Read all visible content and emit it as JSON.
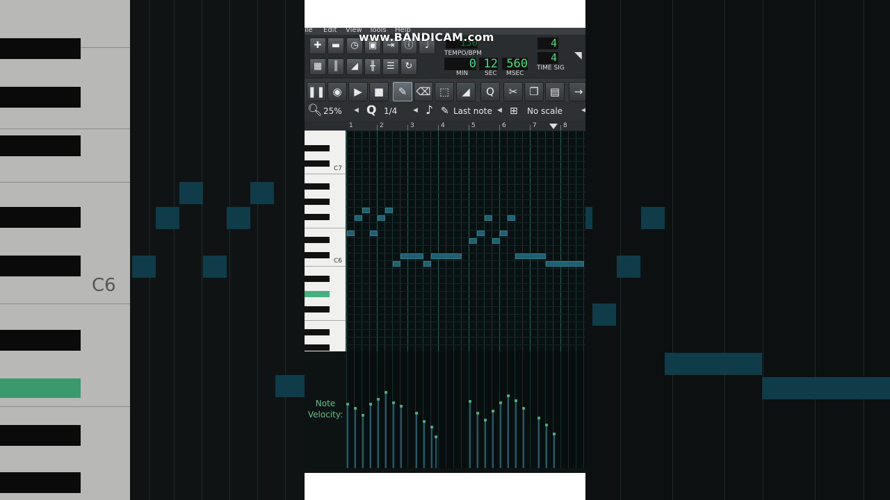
{
  "menu": [
    "ile",
    "Edit",
    "View",
    "Tools",
    "Help"
  ],
  "watermark": "www.BANDICAM.com",
  "transport": {
    "tempo_value": "130",
    "tempo_label": "TEMPO/BPM",
    "min_value": "0",
    "min_label": "MIN",
    "sec_value": "12",
    "sec_label": "SEC",
    "msec_value": "560",
    "msec_label": "MSEC",
    "time_sig_top": "4",
    "time_sig_bottom": "4",
    "time_sig_label": "TIME SIG"
  },
  "options": {
    "zoom": "25%",
    "quantize": "1/4",
    "note_length": "Last note",
    "scale": "No scale"
  },
  "ruler": [
    "1",
    "2",
    "3",
    "4",
    "5",
    "6",
    "7",
    "8"
  ],
  "keys": {
    "c7": "C7",
    "c6": "C6"
  },
  "side_label": "C6",
  "velocity": {
    "label_line1": "Note",
    "label_line2": "Velocity:"
  },
  "colors": {
    "accent": "#46b07e",
    "note": "#1e5f70",
    "lcd": "#3fe07e",
    "grid_bg": "#091012"
  },
  "notes": [
    {
      "pos": 0,
      "row": 13,
      "len": 1
    },
    {
      "pos": 1,
      "row": 11,
      "len": 1
    },
    {
      "pos": 2,
      "row": 10,
      "len": 1
    },
    {
      "pos": 3,
      "row": 13,
      "len": 1
    },
    {
      "pos": 4,
      "row": 11,
      "len": 1
    },
    {
      "pos": 5,
      "row": 10,
      "len": 1
    },
    {
      "pos": 6,
      "row": 17,
      "len": 1
    },
    {
      "pos": 7,
      "row": 16,
      "len": 3
    },
    {
      "pos": 10,
      "row": 17,
      "len": 1
    },
    {
      "pos": 11,
      "row": 16,
      "len": 4
    },
    {
      "pos": 16,
      "row": 14,
      "len": 1
    },
    {
      "pos": 17,
      "row": 13,
      "len": 1
    },
    {
      "pos": 18,
      "row": 11,
      "len": 1
    },
    {
      "pos": 19,
      "row": 14,
      "len": 1
    },
    {
      "pos": 20,
      "row": 13,
      "len": 1
    },
    {
      "pos": 21,
      "row": 11,
      "len": 1
    },
    {
      "pos": 22,
      "row": 16,
      "len": 4
    },
    {
      "pos": 26,
      "row": 17,
      "len": 5
    }
  ],
  "velocities": [
    {
      "pos": 0,
      "level": 0.55
    },
    {
      "pos": 1,
      "level": 0.51
    },
    {
      "pos": 2,
      "level": 0.45
    },
    {
      "pos": 3,
      "level": 0.55
    },
    {
      "pos": 4,
      "level": 0.59
    },
    {
      "pos": 5,
      "level": 0.65
    },
    {
      "pos": 6,
      "level": 0.56
    },
    {
      "pos": 7,
      "level": 0.53
    },
    {
      "pos": 9,
      "level": 0.47
    },
    {
      "pos": 10,
      "level": 0.4
    },
    {
      "pos": 11,
      "level": 0.35
    },
    {
      "pos": 11.5,
      "level": 0.27
    },
    {
      "pos": 16,
      "level": 0.57
    },
    {
      "pos": 17,
      "level": 0.47
    },
    {
      "pos": 18,
      "level": 0.41
    },
    {
      "pos": 19,
      "level": 0.49
    },
    {
      "pos": 20,
      "level": 0.56
    },
    {
      "pos": 21,
      "level": 0.62
    },
    {
      "pos": 22,
      "level": 0.58
    },
    {
      "pos": 23,
      "level": 0.51
    },
    {
      "pos": 25,
      "level": 0.43
    },
    {
      "pos": 26,
      "level": 0.37
    },
    {
      "pos": 27,
      "level": 0.29
    }
  ]
}
